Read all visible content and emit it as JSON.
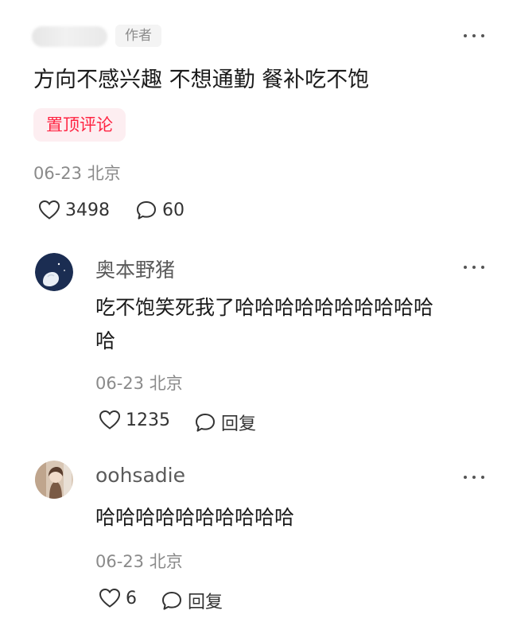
{
  "top_comment": {
    "author_tag": "作者",
    "text": "方向不感兴趣 不想通勤 餐补吃不饱",
    "pinned_label": "置顶评论",
    "date": "06-23",
    "location": "北京",
    "like_count": "3498",
    "comment_count": "60"
  },
  "replies": [
    {
      "username": "奥本野猪",
      "text_line1": "吃不饱笑死我了哈哈哈哈哈哈哈哈哈哈",
      "text_line2": "哈",
      "date": "06-23",
      "location": "北京",
      "like_count": "1235",
      "reply_label": "回复"
    },
    {
      "username": "oohsadie",
      "text_line1": "哈哈哈哈哈哈哈哈哈哈",
      "date": "06-23",
      "location": "北京",
      "like_count": "6",
      "reply_label": "回复"
    }
  ],
  "icons": {
    "more": "more-dots-icon",
    "like": "heart-outline-icon",
    "comment": "speech-bubble-icon"
  },
  "colors": {
    "accent_red": "#ff2442",
    "pin_bg": "#fdeef1",
    "meta_gray": "#8a8a8a"
  }
}
